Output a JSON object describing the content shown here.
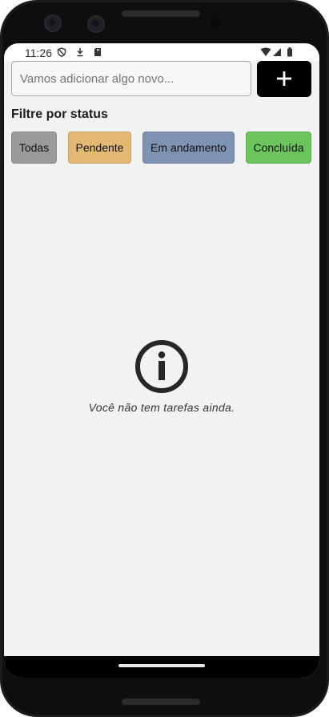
{
  "status_bar": {
    "time": "11:26"
  },
  "new_task": {
    "placeholder": "Vamos adicionar algo novo...",
    "add_icon": "plus-icon"
  },
  "filter": {
    "title": "Filtre por status",
    "chips": [
      {
        "label": "Todas",
        "color": "#9c9a99"
      },
      {
        "label": "Pendente",
        "color": "#e2b872"
      },
      {
        "label": "Em andamento",
        "color": "#7e93b2"
      },
      {
        "label": "Concluída",
        "color": "#6cc45c"
      }
    ]
  },
  "empty_state": {
    "icon": "info-icon",
    "message": "Você não tem tarefas ainda."
  }
}
